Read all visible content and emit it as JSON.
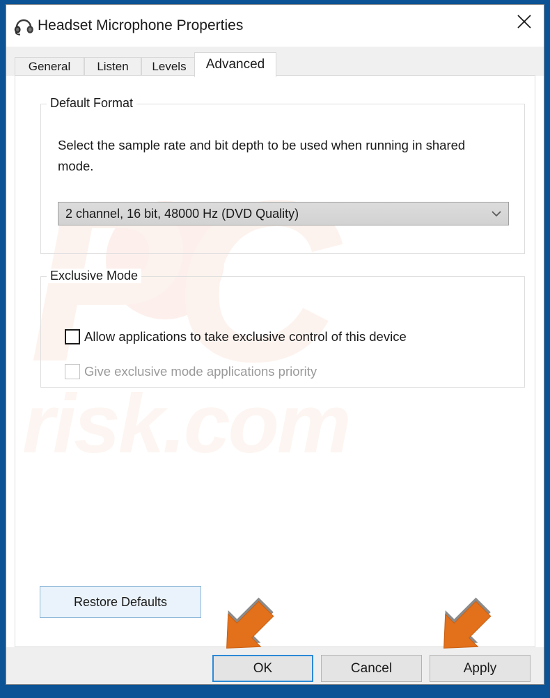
{
  "window": {
    "title": "Headset Microphone Properties",
    "icon": "headset-icon",
    "close_label": "✕",
    "frame_color": "#0b5394"
  },
  "tabs": [
    {
      "label": "General",
      "selected": false
    },
    {
      "label": "Listen",
      "selected": false
    },
    {
      "label": "Levels",
      "selected": false
    },
    {
      "label": "Advanced",
      "selected": true
    }
  ],
  "default_format": {
    "group_label": "Default Format",
    "description": "Select the sample rate and bit depth to be used when running in shared mode.",
    "combo_value": "2 channel, 16 bit, 48000 Hz (DVD Quality)",
    "combo_icon": "chevron-down-icon"
  },
  "exclusive_mode": {
    "group_label": "Exclusive Mode",
    "checkboxes": [
      {
        "label": "Allow applications to take exclusive control of this device",
        "checked": false,
        "disabled": false
      },
      {
        "label": "Give exclusive mode applications priority",
        "checked": false,
        "disabled": true
      }
    ]
  },
  "buttons": {
    "restore_defaults": "Restore Defaults",
    "ok": "OK",
    "cancel": "Cancel",
    "apply": "Apply"
  },
  "annotations": {
    "arrow_color": "#e3701a",
    "arrow_targets": [
      "OK",
      "Apply"
    ]
  },
  "watermark": {
    "logo_text": "PC",
    "domain_text": "risk.com",
    "color": "#fdf3ee"
  }
}
